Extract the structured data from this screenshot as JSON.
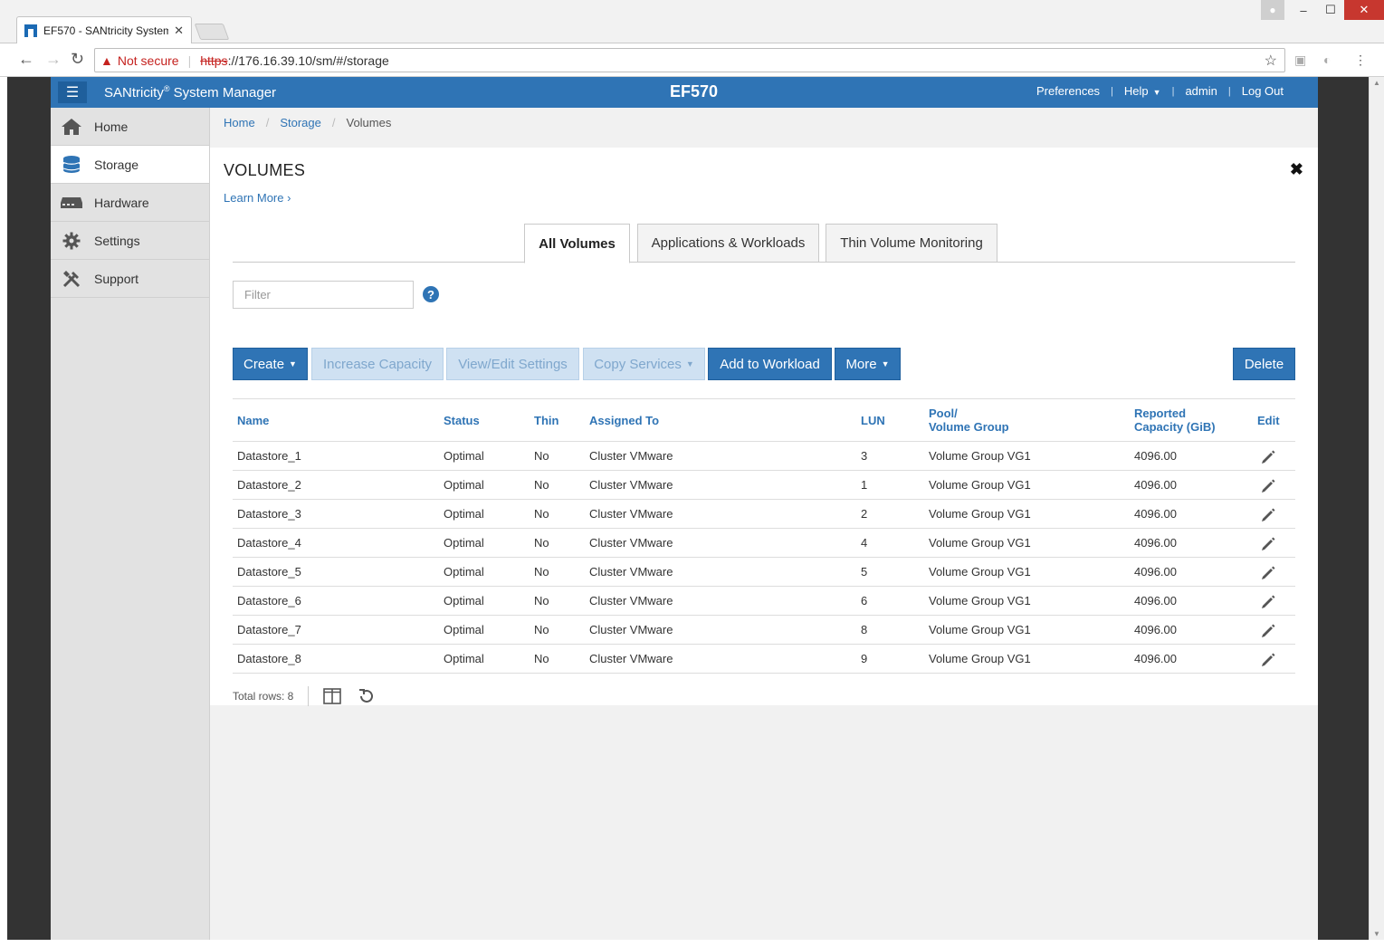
{
  "browser": {
    "tab_title": "EF570 - SANtricity System",
    "not_secure_label": "Not secure",
    "url_protocol": "https",
    "url_rest": "://176.16.39.10/sm/#/storage"
  },
  "header": {
    "brand": "SANtricity",
    "brand_mark": "®",
    "brand_suffix": " System Manager",
    "system_name": "EF570",
    "links": {
      "preferences": "Preferences",
      "help": "Help",
      "user": "admin",
      "logout": "Log Out"
    }
  },
  "sidebar": {
    "items": [
      {
        "label": "Home"
      },
      {
        "label": "Storage"
      },
      {
        "label": "Hardware"
      },
      {
        "label": "Settings"
      },
      {
        "label": "Support"
      }
    ]
  },
  "breadcrumb": {
    "home": "Home",
    "storage": "Storage",
    "current": "Volumes"
  },
  "panel": {
    "title": "VOLUMES",
    "learn_more": "Learn More ›",
    "tabs": [
      "All Volumes",
      "Applications & Workloads",
      "Thin Volume Monitoring"
    ],
    "filter_placeholder": "Filter"
  },
  "toolbar": {
    "create": "Create",
    "increase_capacity": "Increase Capacity",
    "view_edit_settings": "View/Edit Settings",
    "copy_services": "Copy Services",
    "add_to_workload": "Add to Workload",
    "more": "More",
    "delete": "Delete"
  },
  "table": {
    "headers": {
      "name": "Name",
      "status": "Status",
      "thin": "Thin",
      "assigned_to": "Assigned To",
      "lun": "LUN",
      "pool_line1": "Pool/",
      "pool_line2": "Volume Group",
      "capacity_line1": "Reported",
      "capacity_line2": "Capacity (GiB)",
      "edit": "Edit"
    },
    "rows": [
      {
        "name": "Datastore_1",
        "status": "Optimal",
        "thin": "No",
        "assigned": "Cluster VMware",
        "lun": "3",
        "pool": "Volume Group VG1",
        "capacity": "4096.00"
      },
      {
        "name": "Datastore_2",
        "status": "Optimal",
        "thin": "No",
        "assigned": "Cluster VMware",
        "lun": "1",
        "pool": "Volume Group VG1",
        "capacity": "4096.00"
      },
      {
        "name": "Datastore_3",
        "status": "Optimal",
        "thin": "No",
        "assigned": "Cluster VMware",
        "lun": "2",
        "pool": "Volume Group VG1",
        "capacity": "4096.00"
      },
      {
        "name": "Datastore_4",
        "status": "Optimal",
        "thin": "No",
        "assigned": "Cluster VMware",
        "lun": "4",
        "pool": "Volume Group VG1",
        "capacity": "4096.00"
      },
      {
        "name": "Datastore_5",
        "status": "Optimal",
        "thin": "No",
        "assigned": "Cluster VMware",
        "lun": "5",
        "pool": "Volume Group VG1",
        "capacity": "4096.00"
      },
      {
        "name": "Datastore_6",
        "status": "Optimal",
        "thin": "No",
        "assigned": "Cluster VMware",
        "lun": "6",
        "pool": "Volume Group VG1",
        "capacity": "4096.00"
      },
      {
        "name": "Datastore_7",
        "status": "Optimal",
        "thin": "No",
        "assigned": "Cluster VMware",
        "lun": "8",
        "pool": "Volume Group VG1",
        "capacity": "4096.00"
      },
      {
        "name": "Datastore_8",
        "status": "Optimal",
        "thin": "No",
        "assigned": "Cluster VMware",
        "lun": "9",
        "pool": "Volume Group VG1",
        "capacity": "4096.00"
      }
    ]
  },
  "footer": {
    "total_rows": "Total rows: 8"
  },
  "colors": {
    "accent": "#2f74b5",
    "header_bg": "#2f74b5",
    "warning": "#c5221f"
  }
}
